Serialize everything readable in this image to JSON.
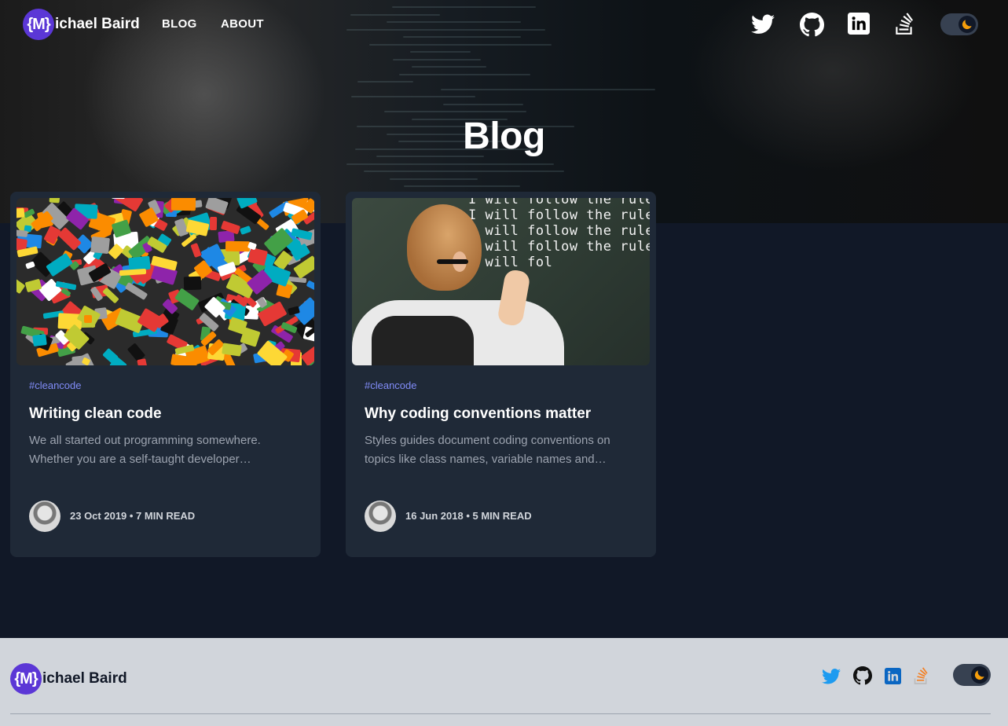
{
  "brand": {
    "badge": "{M}",
    "name": "ichael Baird"
  },
  "nav": {
    "blog": "BLOG",
    "about": "ABOUT"
  },
  "social_icons": [
    "twitter-icon",
    "github-icon",
    "linkedin-icon",
    "stackoverflow-icon"
  ],
  "theme_toggle": {
    "icon": "moon-icon",
    "mode": "dark"
  },
  "hero": {
    "title": "Blog"
  },
  "posts": [
    {
      "tag": "#cleancode",
      "title": "Writing clean code",
      "excerpt": "We all started out programming somewhere. Whether you are a self-taught developer…",
      "meta": "23 Oct 2019 • 7 MIN READ"
    },
    {
      "tag": "#cleancode",
      "title": "Why coding conventions matter",
      "excerpt": "Styles guides document coding conventions on topics like class names, variable names and…",
      "meta": "16 Jun 2018 • 5 MIN READ",
      "image_text": [
        "I will follow the rules",
        "I will follow the rules",
        "I will follow the rules",
        "I will follow the rules",
        "I will fol"
      ]
    }
  ],
  "footer": {
    "brand_badge": "{M}",
    "brand_name": "ichael Baird"
  },
  "colors": {
    "page_bg": "#111827",
    "card_bg": "#1f2937",
    "accent": "#5b37d6",
    "tag": "#818cf8",
    "footer_bg": "#d1d5db",
    "twitter": "#1d9bf0",
    "linkedin": "#0a66c2",
    "stackoverflow": "#f48024",
    "moon": "#f59e0b"
  }
}
